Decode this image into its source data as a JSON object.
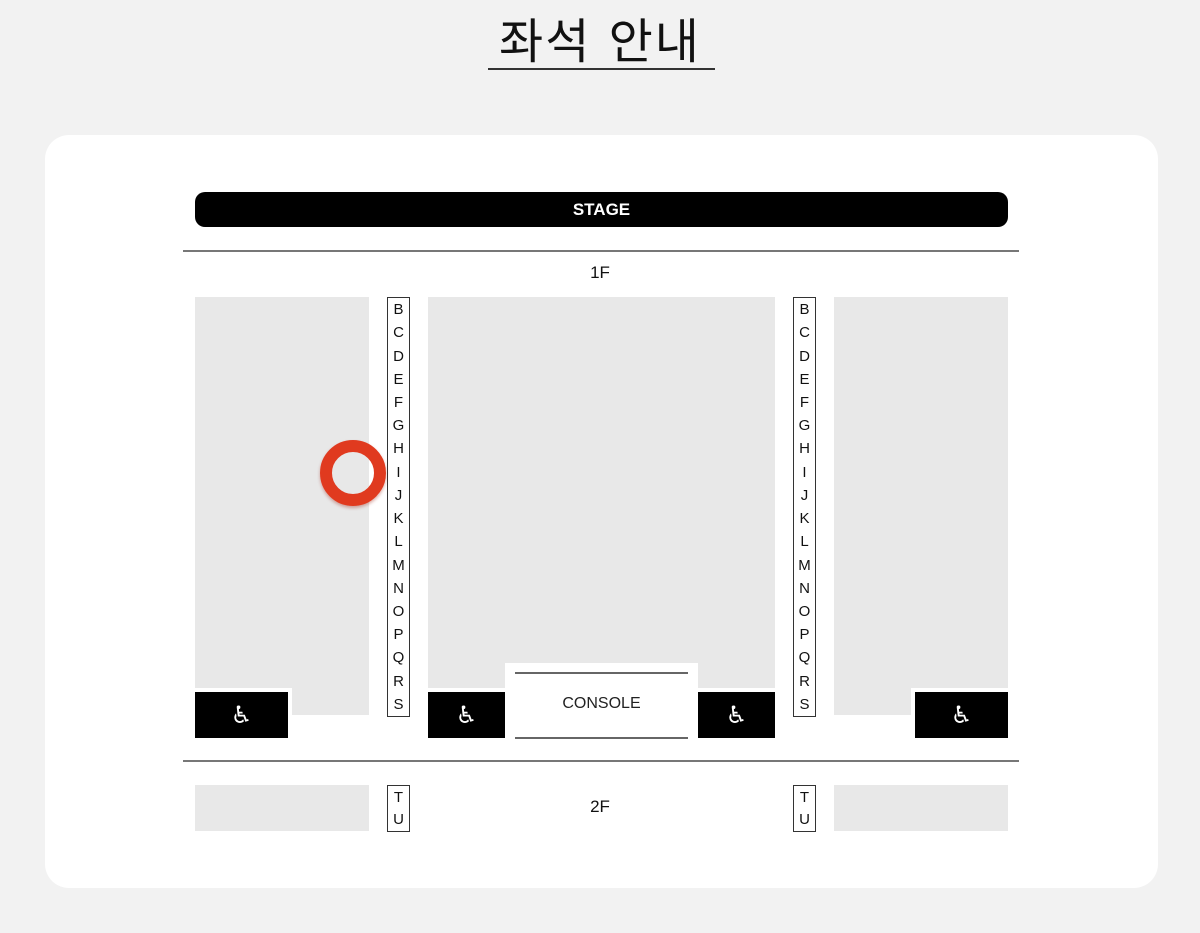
{
  "title": "좌석 안내",
  "stage_label": "STAGE",
  "floors": {
    "first": "1F",
    "second": "2F"
  },
  "row_letters_1f": [
    "B",
    "C",
    "D",
    "E",
    "F",
    "G",
    "H",
    "I",
    "J",
    "K",
    "L",
    "M",
    "N",
    "O",
    "P",
    "Q",
    "R",
    "S"
  ],
  "row_letters_2f": [
    "T",
    "U"
  ],
  "console_label": "CONSOLE",
  "icons": {
    "accessible": "wheelchair-icon",
    "marker": "location-ring-marker"
  },
  "marker_row": "I",
  "marker_section": "left",
  "colors": {
    "marker": "#e03a1f",
    "stage": "#000000",
    "block": "#e8e8e8"
  }
}
